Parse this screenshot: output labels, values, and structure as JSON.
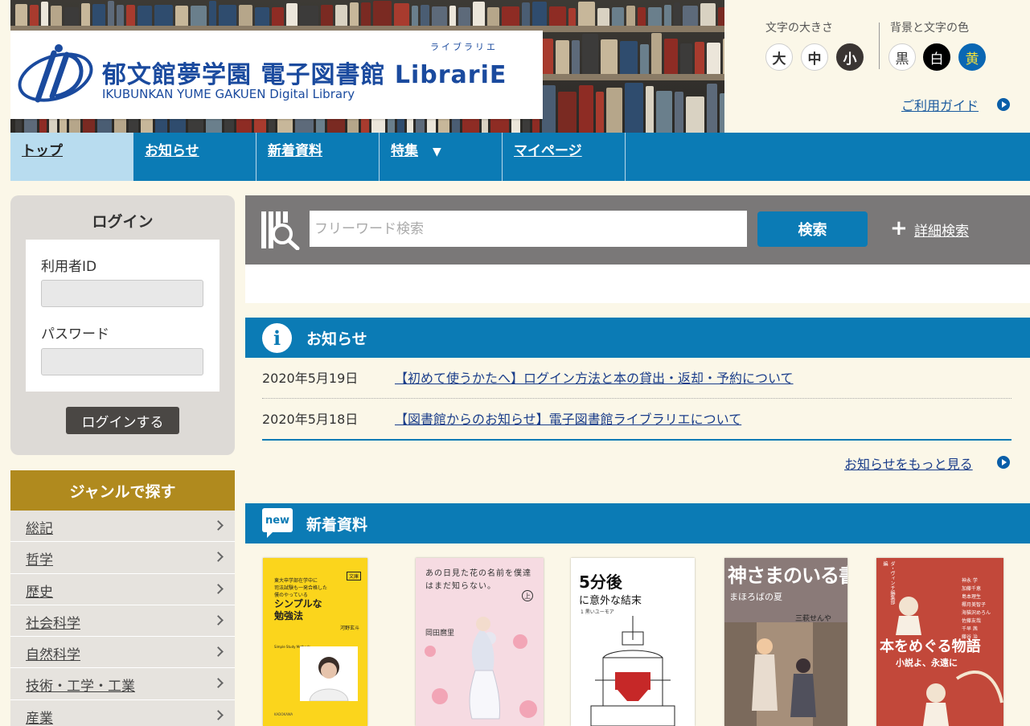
{
  "header": {
    "logo_title": "郁文館夢学園 電子図書館 LibrariE",
    "logo_ruby": "ライブラリエ",
    "logo_subtitle": "IKUBUNKAN YUME GAKUEN Digital Library",
    "font_size_label": "文字の大きさ",
    "font_sizes": [
      "大",
      "中",
      "小"
    ],
    "color_label": "背景と文字の色",
    "color_modes": [
      "黒",
      "白",
      "黄"
    ],
    "guide_link": "ご利用ガイド"
  },
  "nav": {
    "items": [
      {
        "label": "トップ",
        "active": true
      },
      {
        "label": "お知らせ",
        "active": false
      },
      {
        "label": "新着資料",
        "active": false
      },
      {
        "label": "特集",
        "active": false,
        "dropdown": "▼"
      },
      {
        "label": "マイページ",
        "active": false
      }
    ]
  },
  "login": {
    "title": "ログイン",
    "user_id_label": "利用者ID",
    "password_label": "パスワード",
    "submit_label": "ログインする"
  },
  "genre": {
    "title": "ジャンルで探す",
    "items": [
      "総記",
      "哲学",
      "歴史",
      "社会科学",
      "自然科学",
      "技術・工学・工業",
      "産業"
    ]
  },
  "search": {
    "placeholder": "フリーワード検索",
    "button_label": "検索",
    "advanced_label": "詳細検索"
  },
  "news": {
    "title": "お知らせ",
    "items": [
      {
        "date": "2020年5月19日",
        "text": "【初めて使うかたへ】ログイン方法と本の貸出・返却・予約について"
      },
      {
        "date": "2020年5月18日",
        "text": "【図書館からのお知らせ】電子図書館ライブラリエについて"
      }
    ],
    "more_label": "お知らせをもっと見る"
  },
  "new_arrivals": {
    "title": "新着資料",
    "badge": "new",
    "books": [
      {
        "cover_top": "東大卒学部在学中に\n司法試験も一発合格した\n僕のやっている",
        "cover_badge": "文庫",
        "title": "シンプルな\n勉強法",
        "author": "河野玄斗",
        "tagline": "Simple Study Methods",
        "publisher": "KADOKAWA",
        "bg": "#fbd51c"
      },
      {
        "title": "あの日見た花の名前を僕達はまだ知らない。",
        "volume": "上",
        "author": "岡田麿里",
        "bg": "#f6dbe2"
      },
      {
        "title_top": "5分後",
        "title_bottom": "に意外な結末",
        "series": "1 黒いユーモア",
        "bg": "#ffffff"
      },
      {
        "title": "神さまのいる書店",
        "subtitle": "まほろばの夏",
        "author": "三萩せんや",
        "bg": "#8a7a78"
      },
      {
        "editor": "ダ・ヴィンチ編集部 編",
        "authors": [
          "神永 学",
          "加藤千恵",
          "島本理生",
          "椰月美智子",
          "海猫沢めろん",
          "佐藤友哉",
          "千早 茜",
          "藤谷 治"
        ],
        "title": "本をめぐる物語",
        "subtitle": "小説よ、永遠に",
        "bg": "#c2483a"
      }
    ]
  }
}
